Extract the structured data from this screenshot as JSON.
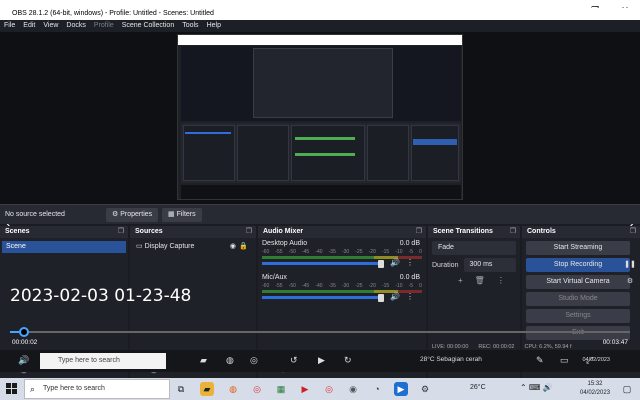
{
  "viewer": {
    "back_icon": "arrow-left-icon",
    "window_buttons": [
      "—",
      "❐",
      "✕"
    ]
  },
  "obs": {
    "title": "OBS 28.1.2 (64-bit, windows) - Profile: Untitled - Scenes: Untitled",
    "menu": [
      "File",
      "Edit",
      "View",
      "Docks",
      "Profile",
      "Scene Collection",
      "Tools",
      "Help"
    ],
    "no_source": "No source selected",
    "properties_label": "Properties",
    "filters_label": "Filters",
    "docks": {
      "scenes": {
        "title": "Scenes",
        "items": [
          "Scene"
        ]
      },
      "sources": {
        "title": "Sources",
        "items": [
          "Display Capture"
        ]
      },
      "mixer": {
        "title": "Audio Mixer",
        "channels": [
          {
            "name": "Desktop Audio",
            "db": "0.0 dB"
          },
          {
            "name": "Mic/Aux",
            "db": "0.0 dB"
          }
        ],
        "scale": [
          "-60",
          "-55",
          "-50",
          "-45",
          "-40",
          "-35",
          "-30",
          "-25",
          "-20",
          "-15",
          "-10",
          "-5",
          "0"
        ]
      },
      "transitions": {
        "title": "Scene Transitions",
        "type": "Fade",
        "duration_label": "Duration",
        "duration_value": "300 ms"
      },
      "controls": {
        "title": "Controls",
        "start_streaming": "Start Streaming",
        "stop_recording": "Stop Recording",
        "start_virtual_camera": "Start Virtual Camera",
        "studio_mode": "Studio Mode",
        "settings": "Settings",
        "exit": "Exit"
      }
    },
    "status": {
      "live": "LIVE: 00:00:00",
      "rec": "REC: 00:00:02",
      "cpu": "CPU: 6.2%, 59.94 f"
    }
  },
  "overlay": {
    "timestamp": "2023-02-03 01-23-48"
  },
  "player": {
    "elapsed": "00:00:02",
    "total": "00:03:47",
    "progress_fraction": 0.01
  },
  "inner_taskbar": {
    "search_placeholder": "Type here to search",
    "weather": "28°C  Sebagian cerah",
    "date": "04/02/2023"
  },
  "taskbar": {
    "search_placeholder": "Type here to search",
    "weather": "26°C",
    "time": "15:32",
    "date": "04/02/2023"
  }
}
